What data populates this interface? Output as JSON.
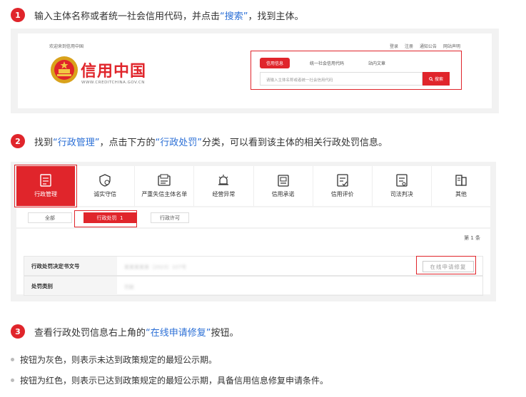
{
  "step1": {
    "number": "1",
    "text_before": "输入主体名称或者统一社会信用代码，并点击",
    "highlight": "“搜索”",
    "text_after": "，找到主体。",
    "site": {
      "welcome": "欢迎来到信用中国",
      "links": [
        "登录",
        "注册",
        "通知公告",
        "网站声明"
      ],
      "brand_name": "信用中国",
      "brand_url": "WWW.CREDITCHINA.GOV.CN",
      "search_tabs": [
        "信用信息",
        "统一社会信用代码",
        "站内文章"
      ],
      "search_placeholder": "请输入主体名称或者统一社会信用代码",
      "search_button": "搜索"
    }
  },
  "step2": {
    "number": "2",
    "text_a": "找到",
    "highlight_a": "“行政管理”",
    "text_b": "，点击下方的",
    "highlight_b": "“行政处罚”",
    "text_c": "分类，可以看到该主体的相关行政处罚信息。",
    "categories": [
      {
        "label": "行政管理",
        "icon": "document-icon"
      },
      {
        "label": "诚实守信",
        "icon": "shield-heart-icon"
      },
      {
        "label": "严重失信主体名单",
        "icon": "blacklist-icon"
      },
      {
        "label": "经营异常",
        "icon": "alarm-icon"
      },
      {
        "label": "信用承诺",
        "icon": "promise-icon"
      },
      {
        "label": "信用评价",
        "icon": "evaluation-icon"
      },
      {
        "label": "司法判决",
        "icon": "judgment-icon"
      },
      {
        "label": "其他",
        "icon": "other-icon"
      }
    ],
    "subtabs": {
      "all": "全部",
      "penalty": "行政处罚",
      "penalty_count": "1",
      "license": "行政许可"
    },
    "result_count": "第 1 条",
    "rows": [
      {
        "label": "行政处罚决定书文号",
        "value": "某某某某某〔2023〕107号"
      },
      {
        "label": "处罚类别",
        "value": "罚款"
      }
    ],
    "repair_button": "在线申请修复"
  },
  "step3": {
    "number": "3",
    "text_before": "查看行政处罚信息右上角的",
    "highlight": "“在线申请修复”",
    "text_after": "按钮。"
  },
  "bullets": [
    "按钮为灰色，则表示未达到政策规定的最短公示期。",
    "按钮为红色，则表示已达到政策规定的最短公示期，具备信用信息修复申请条件。"
  ],
  "colors": {
    "accent": "#e0252b",
    "highlight": "#2b6fd6"
  }
}
